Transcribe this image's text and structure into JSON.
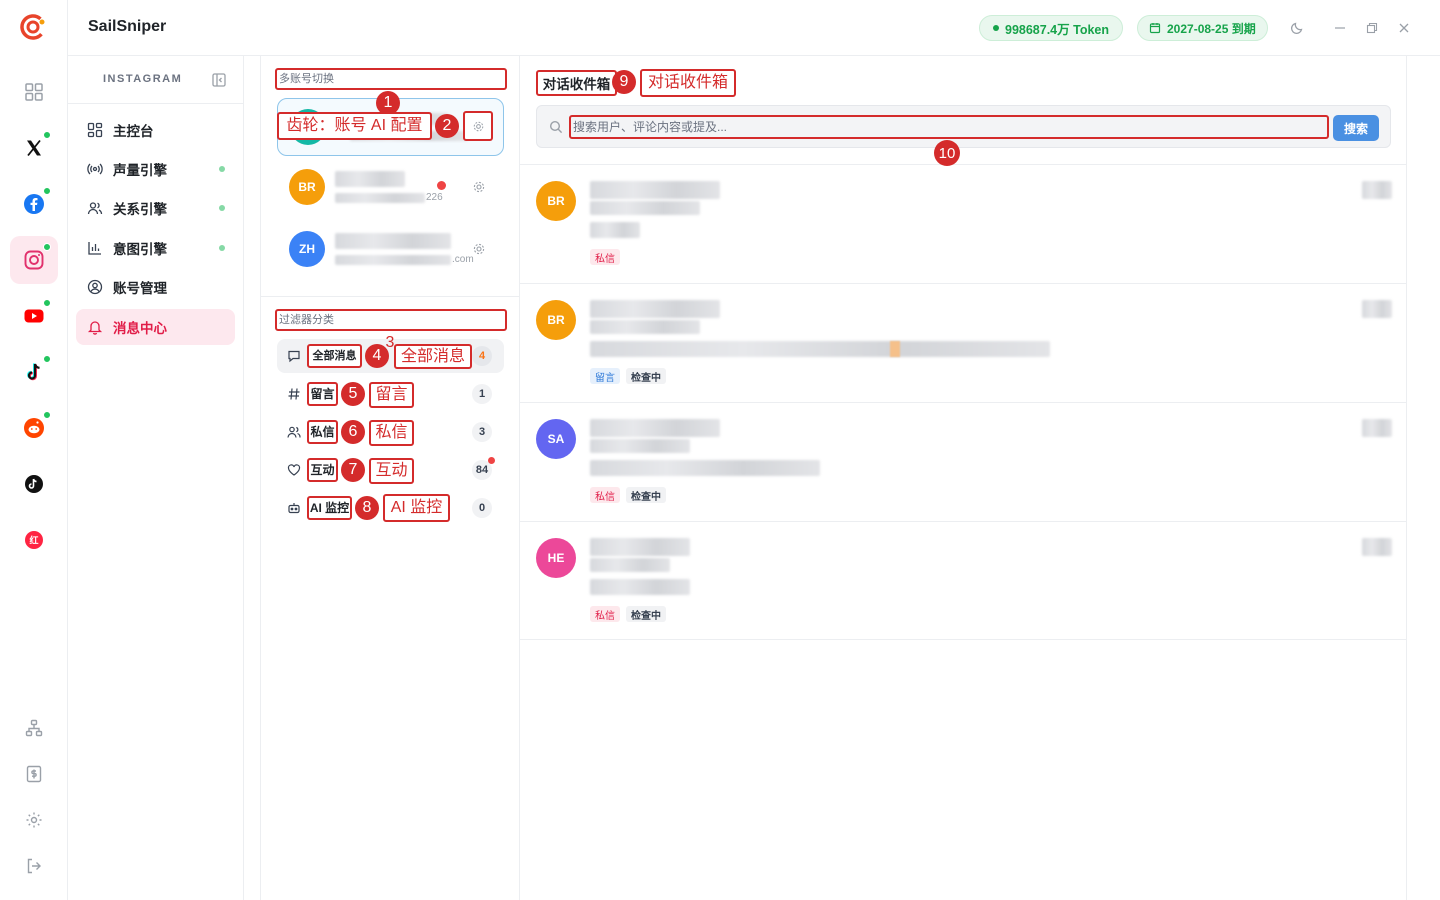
{
  "app": {
    "brand": "SailSniper"
  },
  "header": {
    "token_label": "998687.4万 Token",
    "expire_label": "2027-08-25 到期"
  },
  "rail": {
    "items": [
      {
        "icon": "grid-icon",
        "dot": false,
        "active": false
      },
      {
        "icon": "x-icon",
        "dot": true,
        "active": false
      },
      {
        "icon": "facebook-icon",
        "dot": true,
        "active": false
      },
      {
        "icon": "instagram-icon",
        "dot": true,
        "active": true
      },
      {
        "icon": "youtube-icon",
        "dot": true,
        "active": false
      },
      {
        "icon": "tiktok-icon",
        "dot": true,
        "active": false
      },
      {
        "icon": "reddit-icon",
        "dot": true,
        "active": false
      },
      {
        "icon": "threads-icon",
        "dot": false,
        "active": false
      },
      {
        "icon": "xiaohongshu-icon",
        "dot": false,
        "active": false
      }
    ],
    "bottom": [
      "sitemap-icon",
      "billing-icon",
      "gear-icon",
      "logout-icon"
    ]
  },
  "nav": {
    "title": "INSTAGRAM",
    "items": [
      {
        "label": "主控台",
        "icon": "dashboard-icon",
        "dot": false
      },
      {
        "label": "声量引擎",
        "icon": "broadcast-icon",
        "dot": true
      },
      {
        "label": "关系引擎",
        "icon": "users-icon",
        "dot": true
      },
      {
        "label": "意图引擎",
        "icon": "bar-chart-icon",
        "dot": true
      },
      {
        "label": "账号管理",
        "icon": "user-circle-icon",
        "dot": false
      },
      {
        "label": "消息中心",
        "icon": "bell-icon",
        "dot": false,
        "active": true
      }
    ]
  },
  "accounts": {
    "section_label": "多账号切换",
    "items": [
      {
        "initials": "",
        "color": "#14b8a6",
        "email_tail": ""
      },
      {
        "initials": "BR",
        "color": "#f59e0b",
        "email_tail": "226"
      },
      {
        "initials": "ZH",
        "color": "#3b82f6",
        "email_tail": ".com"
      }
    ]
  },
  "filters": {
    "section_label": "过滤器分类",
    "items": [
      {
        "label": "全部消息",
        "icon": "chat-icon",
        "count": "4"
      },
      {
        "label": "留言",
        "icon": "hash-icon",
        "count": "1"
      },
      {
        "label": "私信",
        "icon": "users-icon",
        "count": "3"
      },
      {
        "label": "互动",
        "icon": "heart-icon",
        "count": "84"
      },
      {
        "label": "AI 监控",
        "icon": "robot-icon",
        "count": "0"
      }
    ]
  },
  "inbox": {
    "title": "对话收件箱",
    "search_placeholder": "搜索用户、评论内容或提及...",
    "search_button": "搜索",
    "conversations": [
      {
        "initials": "BR",
        "color": "#f59e0b",
        "tags": [
          "私信"
        ]
      },
      {
        "initials": "BR",
        "color": "#f59e0b",
        "tags": [
          "留言",
          "检查中"
        ]
      },
      {
        "initials": "SA",
        "color": "#6366f1",
        "tags": [
          "私信",
          "检查中"
        ]
      },
      {
        "initials": "HE",
        "color": "#ec4899",
        "tags": [
          "私信",
          "检查中"
        ]
      }
    ]
  },
  "annotations": {
    "n1": "1",
    "n2": "2",
    "n3": "3",
    "n4": "4",
    "n5": "5",
    "n6": "6",
    "n7": "7",
    "n8": "8",
    "n9": "9",
    "n10": "10",
    "gear_note": "齿轮：账号 AI 配置",
    "all_note": "全部消息",
    "comment_note": "留言",
    "dm_note": "私信",
    "interact_note": "互动",
    "ai_note": "AI 监控",
    "inbox_note": "对话收件箱"
  },
  "colors": {
    "accent": "#e11d48",
    "success": "#16a34a",
    "annotation": "#d42b2b",
    "primary": "#4a90e2"
  }
}
